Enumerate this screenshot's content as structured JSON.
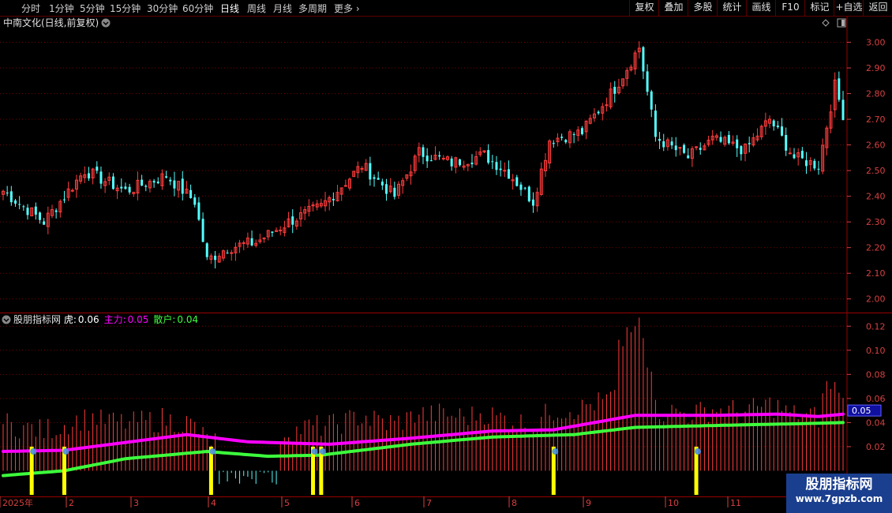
{
  "toolbar": {
    "periods": [
      "分时",
      "1分钟",
      "5分钟",
      "15分钟",
      "30分钟",
      "60分钟",
      "日线",
      "周线",
      "月线",
      "多周期",
      "更多"
    ],
    "active_period": "日线",
    "right_buttons": [
      "复权",
      "叠加",
      "多股",
      "统计",
      "画线",
      "F10",
      "标记",
      "+自选",
      "返回"
    ]
  },
  "main_panel": {
    "title": "中南文化(日线,前复权)",
    "price_ticks": [
      "3.00",
      "2.90",
      "2.80",
      "2.70",
      "2.60",
      "2.50",
      "2.40",
      "2.30",
      "2.20",
      "2.10",
      "2.00"
    ]
  },
  "indicator_panel": {
    "name": "股朋指标网",
    "items": [
      {
        "label": "虎:",
        "value": "0.06",
        "color": "#ffffff"
      },
      {
        "label": "主力:",
        "value": "0.05",
        "color": "#ff00ff"
      },
      {
        "label": "散户:",
        "value": "0.04",
        "color": "#3cff3c"
      }
    ],
    "value_ticks": [
      "0.12",
      "0.10",
      "0.08",
      "0.06",
      "0.04",
      "0.02"
    ],
    "current_value": "0.05"
  },
  "date_axis": [
    "2025年",
    "2",
    "3",
    "4",
    "5",
    "6",
    "7",
    "8",
    "9",
    "10",
    "11"
  ],
  "watermark": {
    "title": "股朋指标网",
    "url": "www.7gpzb.com"
  },
  "colors": {
    "up": "#ff3c3c",
    "down": "#54ffff",
    "grid": "#7a0000",
    "main_line": "#ff00ff",
    "retail_line": "#3cff3c",
    "signal": "#ffff00"
  },
  "chart_data": [
    {
      "type": "candlestick",
      "ylim": [
        1.95,
        3.1
      ],
      "close_trend": [
        {
          "index": 0,
          "close": 2.42
        },
        {
          "index": 10,
          "close": 2.3
        },
        {
          "index": 20,
          "close": 2.5
        },
        {
          "index": 30,
          "close": 2.42
        },
        {
          "index": 40,
          "close": 2.48
        },
        {
          "index": 47,
          "close": 2.38
        },
        {
          "index": 50,
          "close": 2.15
        },
        {
          "index": 55,
          "close": 2.2
        },
        {
          "index": 62,
          "close": 2.22
        },
        {
          "index": 70,
          "close": 2.3
        },
        {
          "index": 78,
          "close": 2.36
        },
        {
          "index": 88,
          "close": 2.52
        },
        {
          "index": 96,
          "close": 2.4
        },
        {
          "index": 102,
          "close": 2.57
        },
        {
          "index": 110,
          "close": 2.53
        },
        {
          "index": 118,
          "close": 2.56
        },
        {
          "index": 124,
          "close": 2.49
        },
        {
          "index": 130,
          "close": 2.38
        },
        {
          "index": 134,
          "close": 2.62
        },
        {
          "index": 142,
          "close": 2.65
        },
        {
          "index": 150,
          "close": 2.82
        },
        {
          "index": 156,
          "close": 2.98
        },
        {
          "index": 160,
          "close": 2.63
        },
        {
          "index": 168,
          "close": 2.55
        },
        {
          "index": 174,
          "close": 2.62
        },
        {
          "index": 182,
          "close": 2.58
        },
        {
          "index": 188,
          "close": 2.7
        },
        {
          "index": 194,
          "close": 2.55
        },
        {
          "index": 200,
          "close": 2.52
        },
        {
          "index": 204,
          "close": 2.83
        },
        {
          "index": 206,
          "close": 2.72
        }
      ]
    },
    {
      "type": "line",
      "ylim": [
        -0.02,
        0.13
      ],
      "series": [
        {
          "name": "主力",
          "points": [
            {
              "index": 0,
              "value": 0.016
            },
            {
              "index": 15,
              "value": 0.017
            },
            {
              "index": 45,
              "value": 0.03
            },
            {
              "index": 60,
              "value": 0.024
            },
            {
              "index": 80,
              "value": 0.022
            },
            {
              "index": 100,
              "value": 0.027
            },
            {
              "index": 120,
              "value": 0.033
            },
            {
              "index": 135,
              "value": 0.034
            },
            {
              "index": 155,
              "value": 0.046
            },
            {
              "index": 175,
              "value": 0.046
            },
            {
              "index": 190,
              "value": 0.047
            },
            {
              "index": 200,
              "value": 0.045
            },
            {
              "index": 206,
              "value": 0.047
            }
          ]
        },
        {
          "name": "散户",
          "points": [
            {
              "index": 0,
              "value": -0.004
            },
            {
              "index": 15,
              "value": 0.0
            },
            {
              "index": 30,
              "value": 0.01
            },
            {
              "index": 50,
              "value": 0.016
            },
            {
              "index": 65,
              "value": 0.012
            },
            {
              "index": 78,
              "value": 0.013
            },
            {
              "index": 100,
              "value": 0.022
            },
            {
              "index": 120,
              "value": 0.028
            },
            {
              "index": 140,
              "value": 0.03
            },
            {
              "index": 155,
              "value": 0.036
            },
            {
              "index": 180,
              "value": 0.038
            },
            {
              "index": 195,
              "value": 0.039
            },
            {
              "index": 206,
              "value": 0.04
            }
          ]
        }
      ],
      "signal_indices": [
        7,
        15,
        51,
        76,
        78,
        135,
        170
      ]
    }
  ]
}
